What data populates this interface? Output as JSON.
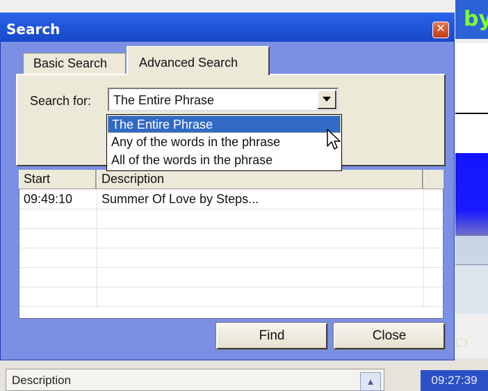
{
  "background_app": {
    "title_fragment": "by",
    "description_header": "Description",
    "clock": "09:27:39",
    "folder_icon": "folder-icon",
    "scroll_up_icon": "scroll-up-icon"
  },
  "dialog": {
    "title": "Search",
    "close_icon": "close-icon",
    "tabs": [
      {
        "label": "Basic Search",
        "active": false
      },
      {
        "label": "Advanced Search",
        "active": true
      }
    ],
    "search_for": {
      "label": "Search for:",
      "value": "The Entire Phrase",
      "dropdown_icon": "chevron-down-icon",
      "options": [
        {
          "label": "The Entire Phrase",
          "selected": true
        },
        {
          "label": "Any of the words in the phrase",
          "selected": false
        },
        {
          "label": "All of the words in the phrase",
          "selected": false
        }
      ]
    },
    "results": {
      "columns": [
        "Start",
        "Description",
        ""
      ],
      "rows": [
        {
          "start": "09:49:10",
          "description": "Summer Of Love by Steps..."
        },
        {
          "start": "",
          "description": ""
        },
        {
          "start": "",
          "description": ""
        },
        {
          "start": "",
          "description": ""
        },
        {
          "start": "",
          "description": ""
        },
        {
          "start": "",
          "description": ""
        }
      ]
    },
    "buttons": {
      "find": "Find",
      "close": "Close"
    }
  },
  "colors": {
    "titlebar": "#1f56dc",
    "dialog_body": "#7b8fe4",
    "panel": "#ece9d8",
    "selection": "#316ac5",
    "close_button": "#d4502c"
  }
}
